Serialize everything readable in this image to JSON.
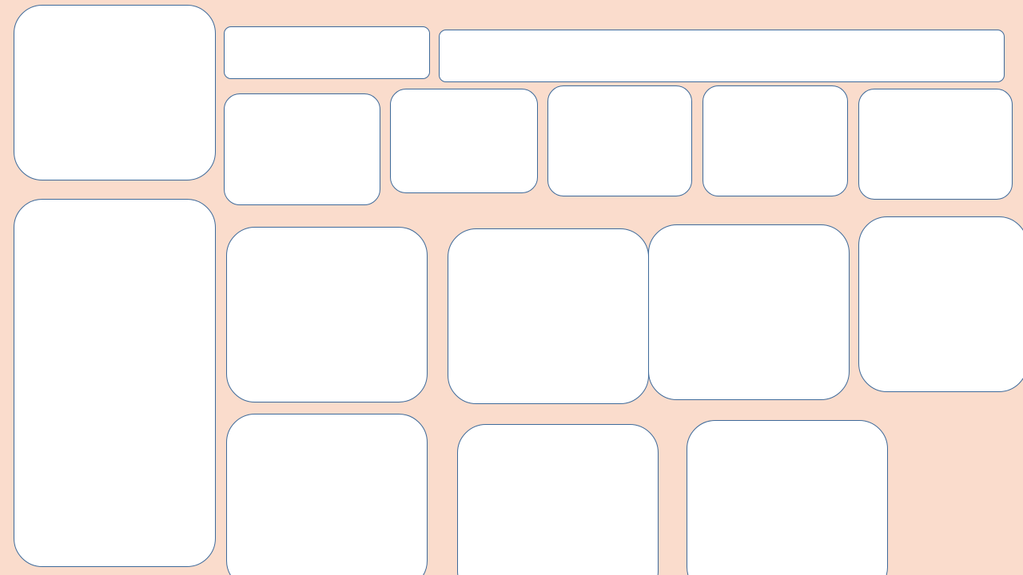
{
  "theme": {
    "background": "#FADCCC",
    "panel_fill": "#FFFFFF",
    "panel_border": "#3E6A9A"
  }
}
